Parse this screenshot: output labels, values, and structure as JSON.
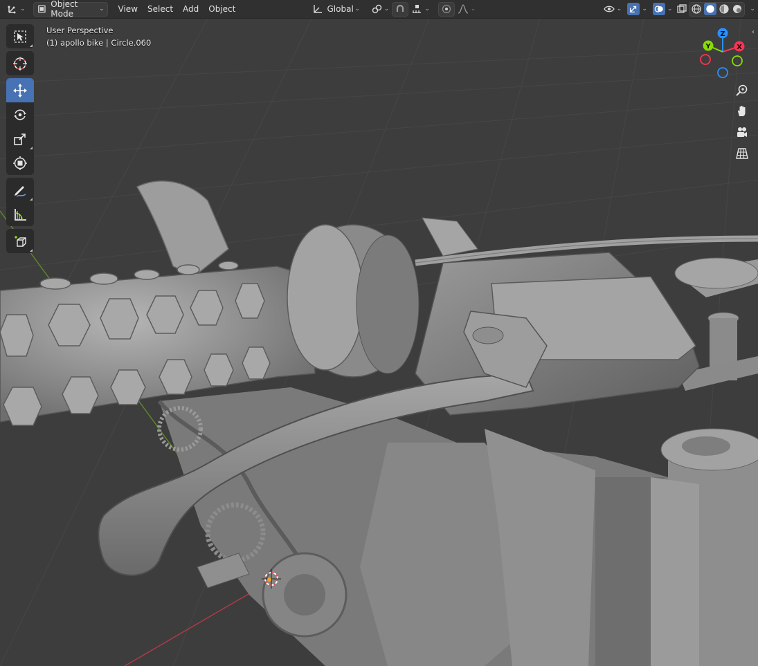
{
  "header": {
    "editor_type_icon": "axis-icon",
    "mode": "Object Mode",
    "menus": [
      "View",
      "Select",
      "Add",
      "Object"
    ],
    "transform_orientation": "Global"
  },
  "viewport": {
    "perspective_label": "User Perspective",
    "object_label": "(1) apollo bike | Circle.060"
  },
  "toolbar": {
    "tools": [
      {
        "name": "select-box",
        "icon": "select-box-icon"
      },
      {
        "name": "cursor",
        "icon": "cursor-icon"
      },
      {
        "name": "move",
        "icon": "move-icon",
        "active": true
      },
      {
        "name": "rotate",
        "icon": "rotate-icon"
      },
      {
        "name": "scale",
        "icon": "scale-icon"
      },
      {
        "name": "transform",
        "icon": "transform-icon"
      },
      {
        "name": "annotate",
        "icon": "annotate-icon"
      },
      {
        "name": "measure",
        "icon": "measure-icon"
      },
      {
        "name": "add-cube",
        "icon": "add-cube-icon"
      }
    ]
  },
  "gizmo": {
    "x": "X",
    "y": "Y",
    "z": "Z"
  },
  "colors": {
    "accent": "#4772b3",
    "header_bg": "#303030",
    "viewport_bg": "#3d3d3d",
    "axis_x": "#ff3352",
    "axis_y": "#8bdc00",
    "axis_z": "#2890ff"
  }
}
